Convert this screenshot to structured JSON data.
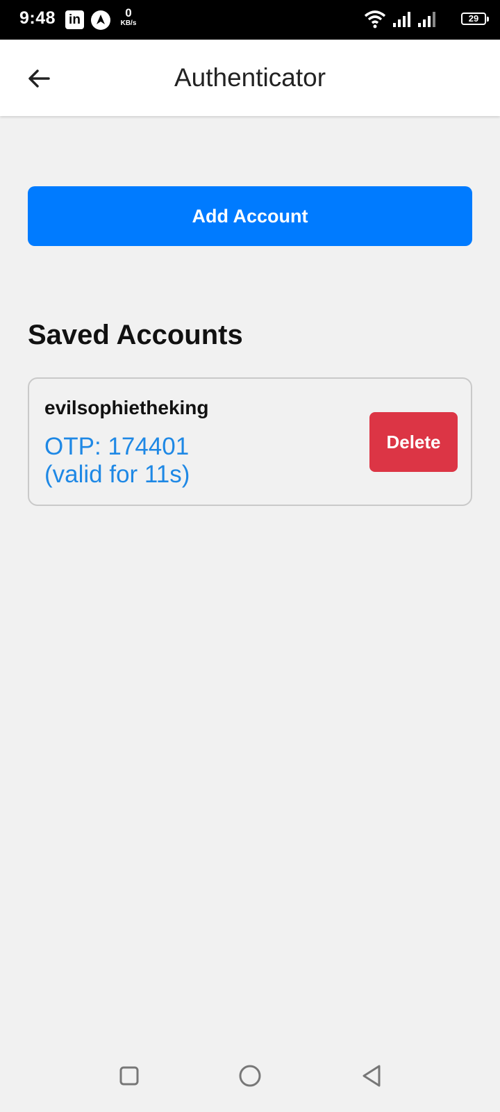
{
  "status_bar": {
    "time": "9:48",
    "linkedin_label": "in",
    "speed_value": "0",
    "speed_unit": "KB/s",
    "battery": "29"
  },
  "header": {
    "title": "Authenticator"
  },
  "actions": {
    "add_account_label": "Add Account"
  },
  "saved_accounts": {
    "title": "Saved Accounts",
    "items": [
      {
        "name": "evilsophietheking",
        "otp": "OTP: 174401",
        "valid": "(valid for 11s)",
        "delete_label": "Delete"
      }
    ]
  },
  "colors": {
    "primary": "#007bff",
    "danger": "#dc3545",
    "otp_text": "#1e88e5",
    "background": "#f1f1f1"
  }
}
